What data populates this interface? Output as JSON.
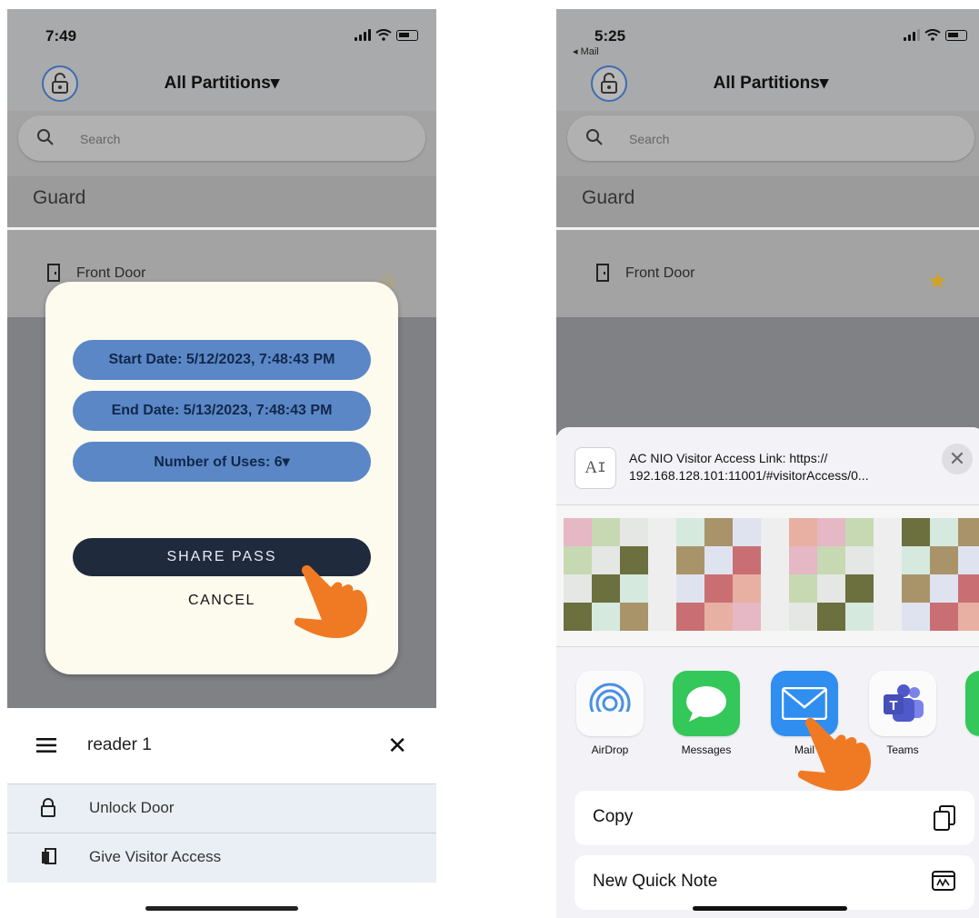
{
  "left": {
    "status": {
      "time": "7:49"
    },
    "header": {
      "partition_label": "All Partitions▾"
    },
    "search": {
      "placeholder": "Search"
    },
    "section": {
      "title": "Guard"
    },
    "door": {
      "label": "Front Door"
    },
    "modal": {
      "start_date": "Start Date: 5/12/2023, 7:48:43 PM",
      "end_date": "End Date: 5/13/2023, 7:48:43 PM",
      "uses": "Number of Uses: 6▾",
      "share_label": "SHARE PASS",
      "cancel_label": "CANCEL"
    },
    "sheet": {
      "title": "reader 1",
      "items": [
        {
          "label": "Unlock Door",
          "icon": "lock-icon"
        },
        {
          "label": "Give Visitor Access",
          "icon": "visitor-door-icon"
        }
      ]
    }
  },
  "right": {
    "status": {
      "time": "5:25",
      "back_label": "◂ Mail"
    },
    "header": {
      "partition_label": "All Partitions▾"
    },
    "search": {
      "placeholder": "Search"
    },
    "section": {
      "title": "Guard"
    },
    "door": {
      "label": "Front Door"
    },
    "share": {
      "link_line1": "AC NIO Visitor Access Link: https://",
      "link_line2": "192.168.128.101:11001/#visitorAccess/0...",
      "apps": [
        {
          "label": "AirDrop",
          "icon": "airdrop-icon"
        },
        {
          "label": "Messages",
          "icon": "messages-icon"
        },
        {
          "label": "Mail",
          "icon": "mail-icon"
        },
        {
          "label": "Teams",
          "icon": "teams-icon"
        }
      ],
      "actions": [
        {
          "label": "Copy",
          "icon": "copy-icon"
        },
        {
          "label": "New Quick Note",
          "icon": "quick-note-icon"
        }
      ]
    }
  },
  "colors": {
    "accent_blue": "#5b87c6",
    "share_button": "#1f2a3d",
    "star_yellow": "#d4a21c",
    "pointer_hand": "#f07a24"
  }
}
